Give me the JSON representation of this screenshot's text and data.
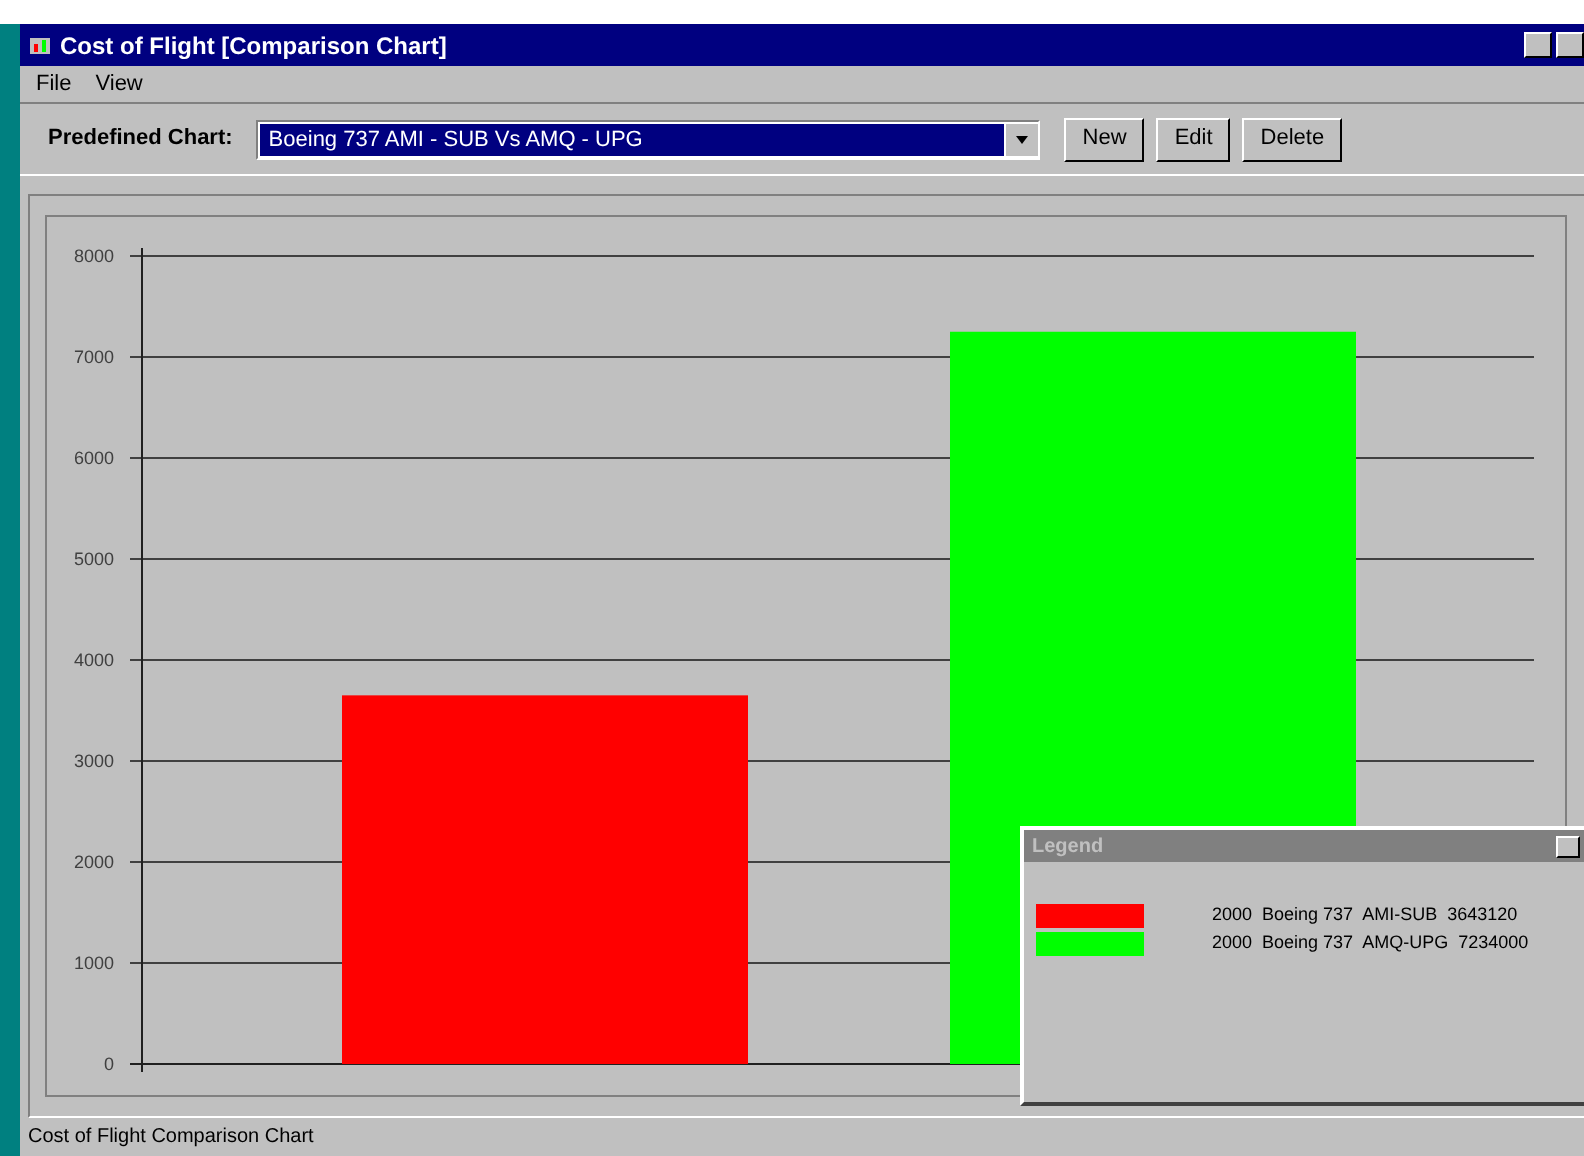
{
  "window": {
    "title": "Cost of Flight [Comparison Chart]"
  },
  "menu": [
    "File",
    "View"
  ],
  "toolbar": {
    "label": "Predefined Chart:",
    "combo_value": "Boeing 737 AMI - SUB Vs AMQ - UPG",
    "buttons": [
      "New",
      "Edit",
      "Delete"
    ]
  },
  "chart": {
    "chart_data": {
      "type": "bar",
      "grid": true,
      "values": [
        3650,
        7250
      ],
      "ylim": [
        0,
        8000
      ],
      "yticks": [
        0,
        1000,
        2000,
        3000,
        4000,
        5000,
        6000,
        7000,
        8000
      ]
    }
  },
  "legend": {
    "title": "Legend",
    "items": [
      {
        "label": "2000  Boeing 737  AMI-SUB  3643120",
        "color": "#ff0000"
      },
      {
        "label": "2000  Boeing 737  AMQ-UPG  7234000",
        "color": "#00ff00"
      }
    ]
  },
  "status_bar": "Cost of Flight Comparison Chart"
}
